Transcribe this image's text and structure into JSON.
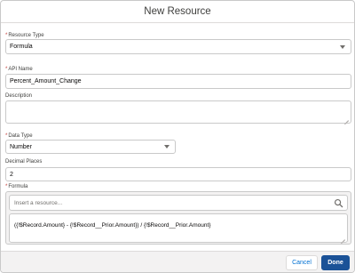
{
  "modal": {
    "title": "New Resource"
  },
  "form": {
    "resource_type": {
      "label": "Resource Type",
      "required": "*",
      "value": "Formula"
    },
    "api_name": {
      "label": "API Name",
      "required": "*",
      "value": "Percent_Amount_Change"
    },
    "description": {
      "label": "Description",
      "value": ""
    },
    "data_type": {
      "label": "Data Type",
      "required": "*",
      "value": "Number"
    },
    "decimal_places": {
      "label": "Decimal Places",
      "value": "2"
    },
    "formula": {
      "label": "Formula",
      "required": "*",
      "search_placeholder": "Insert a resource...",
      "value": "({!$Record.Amount} - {!$Record__Prior.Amount}) / {!$Record__Prior.Amount}"
    }
  },
  "footer": {
    "cancel_label": "Cancel",
    "done_label": "Done"
  },
  "colors": {
    "primary_button": "#1b5297",
    "link": "#0070d2",
    "required": "#c23934"
  },
  "icons": {
    "search": "search-icon",
    "select": "chevron-down-icon"
  }
}
